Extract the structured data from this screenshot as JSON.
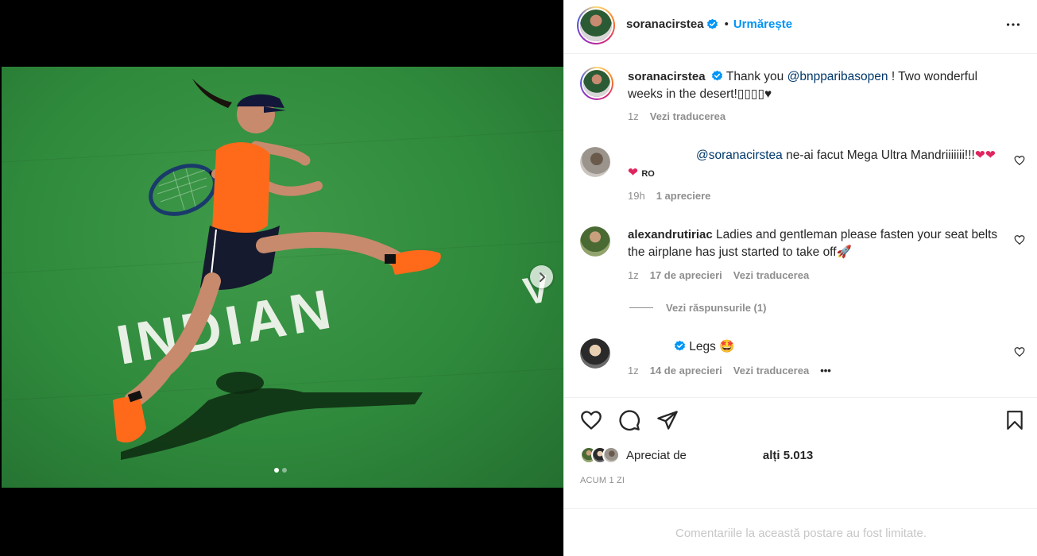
{
  "post": {
    "author": "soranacirstea",
    "follow_label": "Urmărește",
    "separator": "•"
  },
  "caption": {
    "author": "soranacirstea",
    "text_before": "Thank you ",
    "mention": "@bnpparibasopen",
    "text_after": " ! Two wonderful weeks in the desert!▯▯▯▯♥",
    "time": "1z",
    "translate": "Vezi traducerea"
  },
  "comments": [
    {
      "author": "",
      "mention": "@soranacirstea",
      "text": " ne-ai facut Mega Ultra Mandriiiiiii!!!",
      "emoji": "❤❤❤",
      "flag": "RO",
      "time": "19h",
      "likes": "1 apreciere"
    },
    {
      "author": "alexandrutiriac",
      "text": " Ladies and gentleman please fasten your seat belts the airplane has just started to take off",
      "emoji": "🚀",
      "time": "1z",
      "likes": "17 de aprecieri",
      "translate": "Vezi traducerea",
      "replies": "Vezi răspunsurile (1)"
    },
    {
      "author": "",
      "text": " Legs ",
      "emoji": "🤩",
      "time": "1z",
      "likes": "14 de aprecieri",
      "translate": "Vezi traducerea",
      "more": "•••"
    }
  ],
  "likes_summary": {
    "prefix": "Apreciat de",
    "suffix": "alți 5.013"
  },
  "timestamp": "ACUM 1 ZI",
  "comments_limited": "Comentariile la această postare au fost limitate.",
  "photo": {
    "court_text": "INDIAN",
    "court_text_right": "V"
  },
  "colors": {
    "accent": "#0095f6",
    "court_green": "#2f8a3c",
    "outfit_orange": "#ff6a1a"
  },
  "icons": [
    "verified-badge-icon",
    "more-options-icon",
    "heart-icon",
    "comment-icon",
    "share-icon",
    "bookmark-icon",
    "chevron-right-icon"
  ]
}
